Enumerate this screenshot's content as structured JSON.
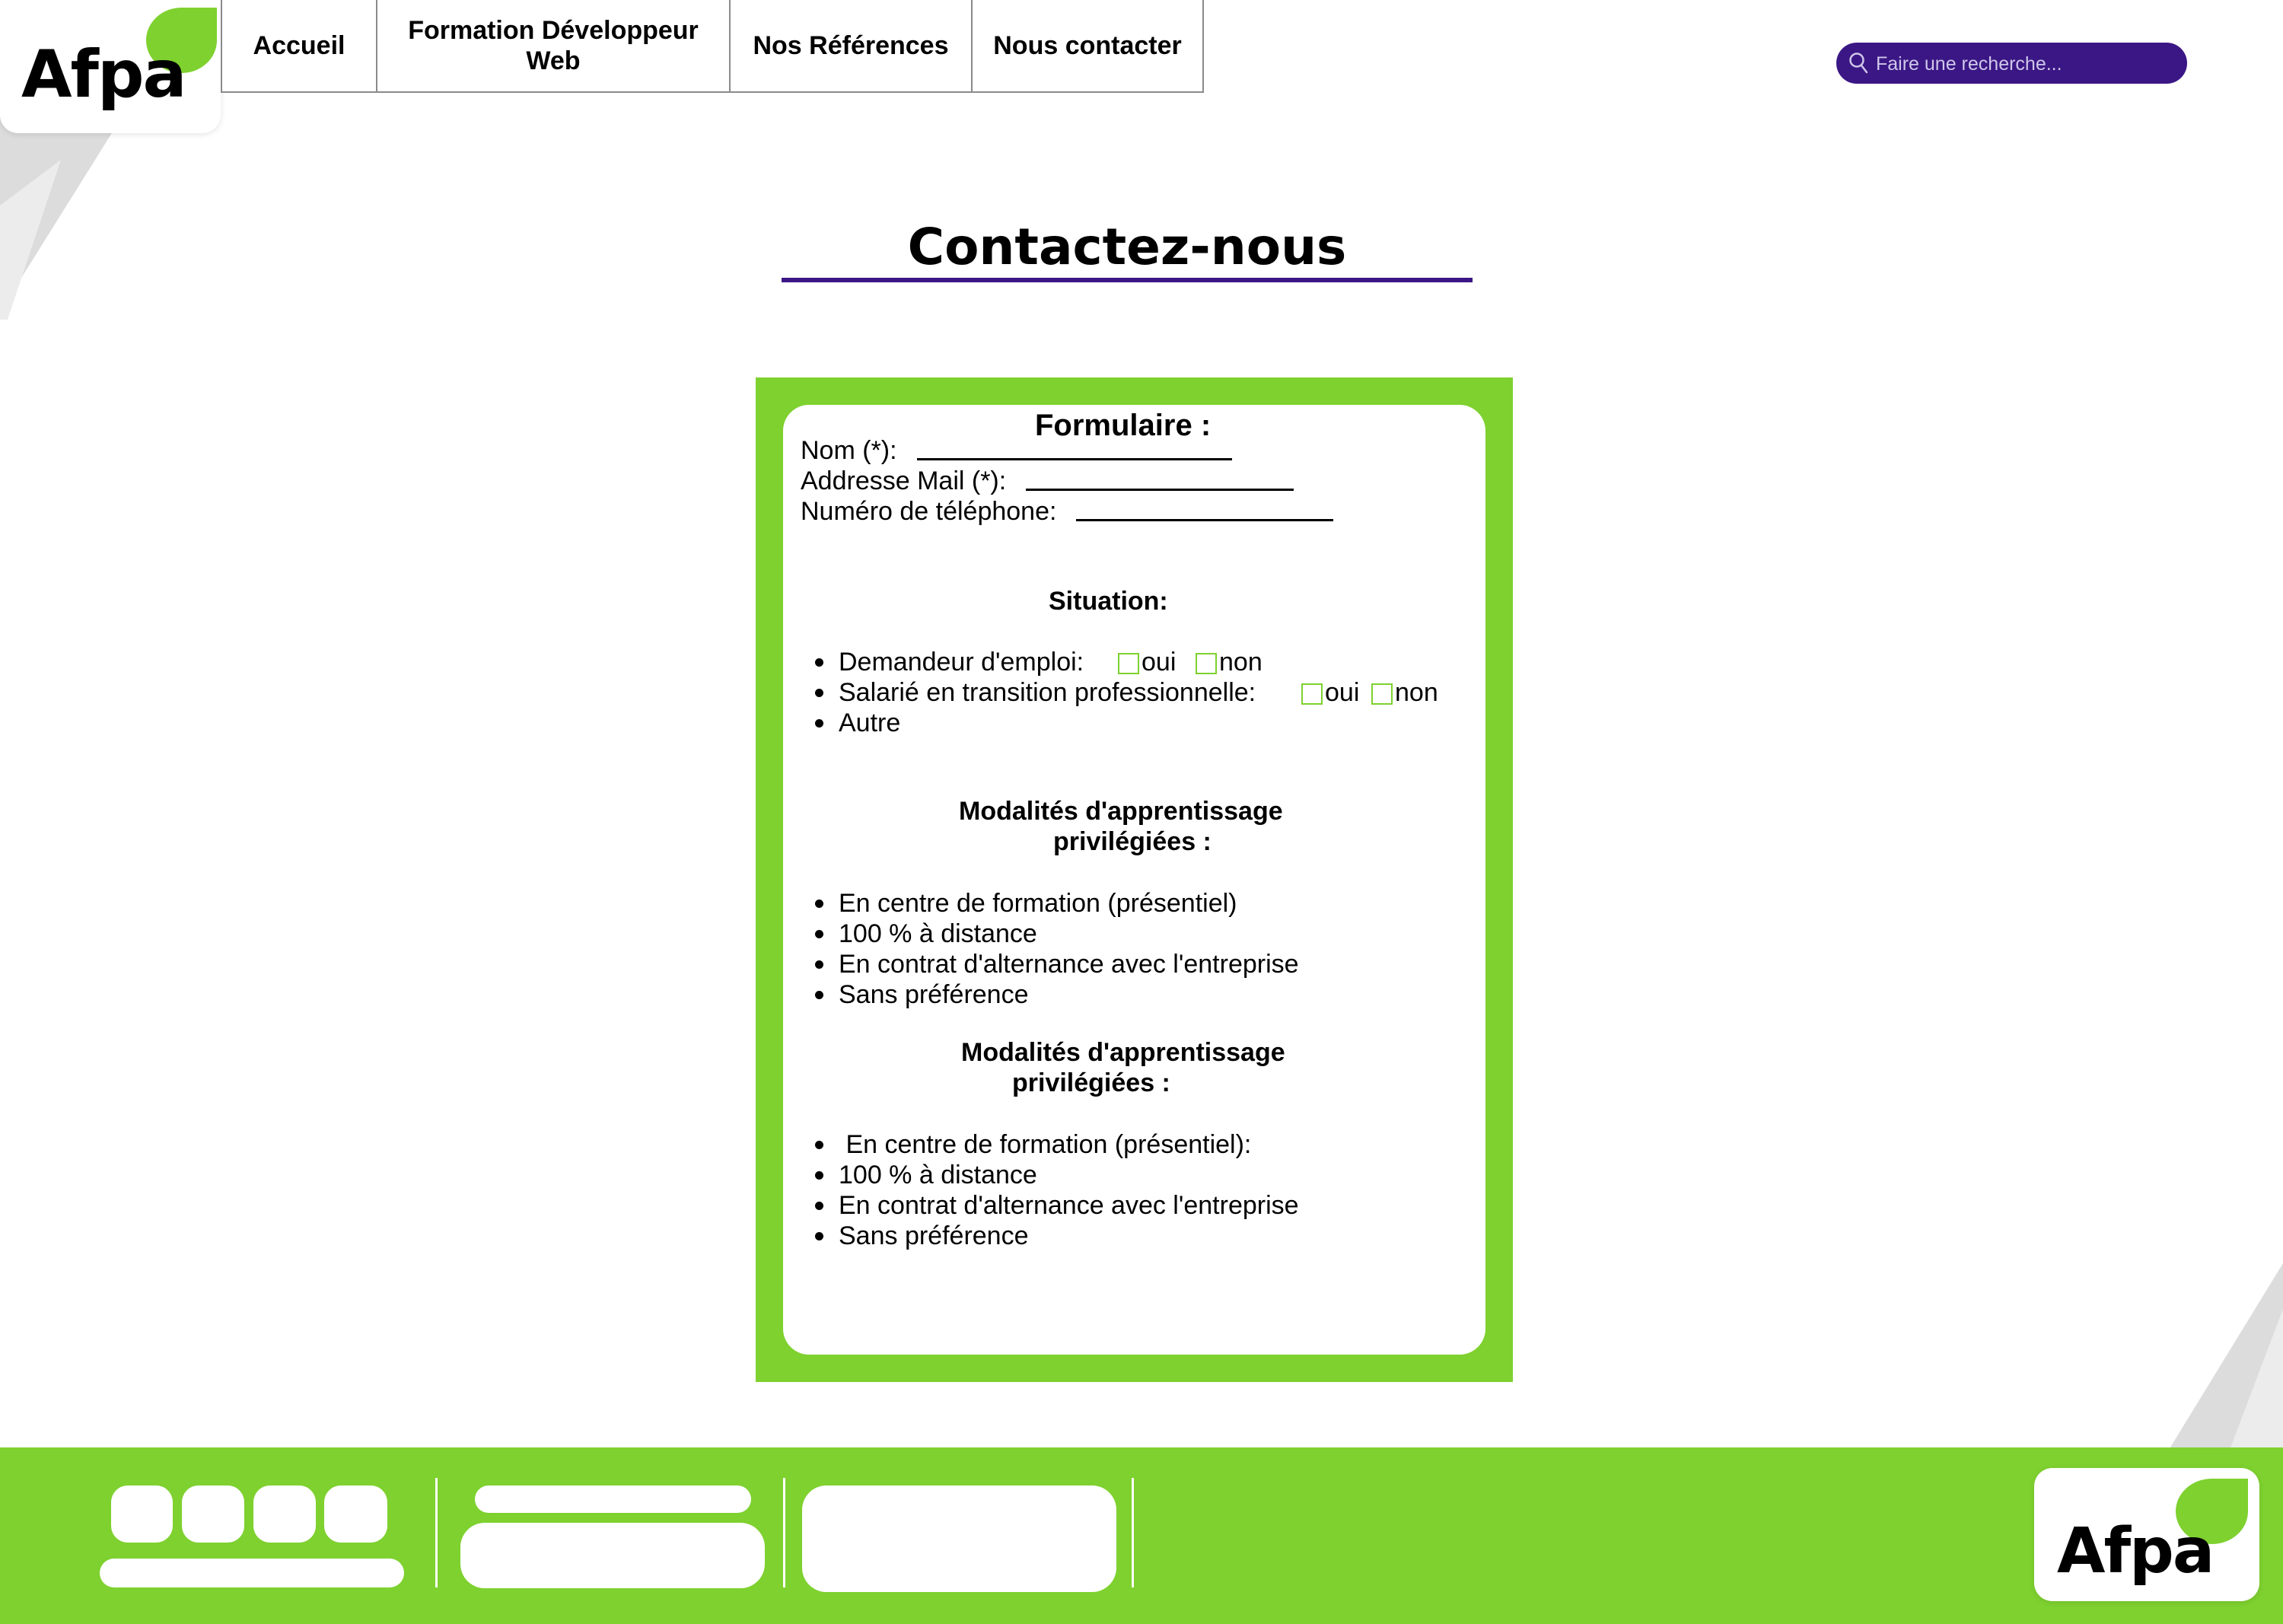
{
  "brand": {
    "logo_text": "Afpa",
    "accent": "#7ed12f",
    "secondary": "#3b1785"
  },
  "nav": {
    "items": [
      {
        "label": "Accueil"
      },
      {
        "label": "Formation Développeur Web",
        "line1": "Formation Développeur",
        "line2": "Web"
      },
      {
        "label": "Nos Références"
      },
      {
        "label": "Nous contacter"
      }
    ]
  },
  "search": {
    "placeholder": "Faire une recherche...",
    "icon": "search-icon"
  },
  "page": {
    "title": "Contactez-nous"
  },
  "form": {
    "heading": "Formulaire :",
    "fields": [
      {
        "label": "Nom (*):"
      },
      {
        "label": "Addresse Mail (*):"
      },
      {
        "label": "Numéro de téléphone:"
      }
    ],
    "situation": {
      "heading": "Situation:",
      "items": [
        {
          "label": "Demandeur d'emploi:",
          "opt_yes": "oui",
          "opt_no": "non"
        },
        {
          "label": "Salarié en transition professionnelle:",
          "opt_yes": "oui",
          "opt_no": "non"
        },
        {
          "label": "Autre"
        }
      ]
    },
    "modalites_1": {
      "heading_line1": "Modalités d'apprentissage",
      "heading_line2": "privilégiées :",
      "items": [
        "En centre de formation (présentiel)",
        "100 % à distance",
        "En contrat d'alternance avec l'entreprise",
        "Sans préférence"
      ]
    },
    "modalites_2": {
      "heading_line1": "Modalités d'apprentissage",
      "heading_line2": "privilégiées :",
      "items": [
        " En centre de formation (présentiel):",
        "100 % à distance",
        "En contrat d'alternance avec l'entreprise",
        "Sans préférence"
      ]
    }
  },
  "footer": {
    "logo_text": "Afpa"
  }
}
